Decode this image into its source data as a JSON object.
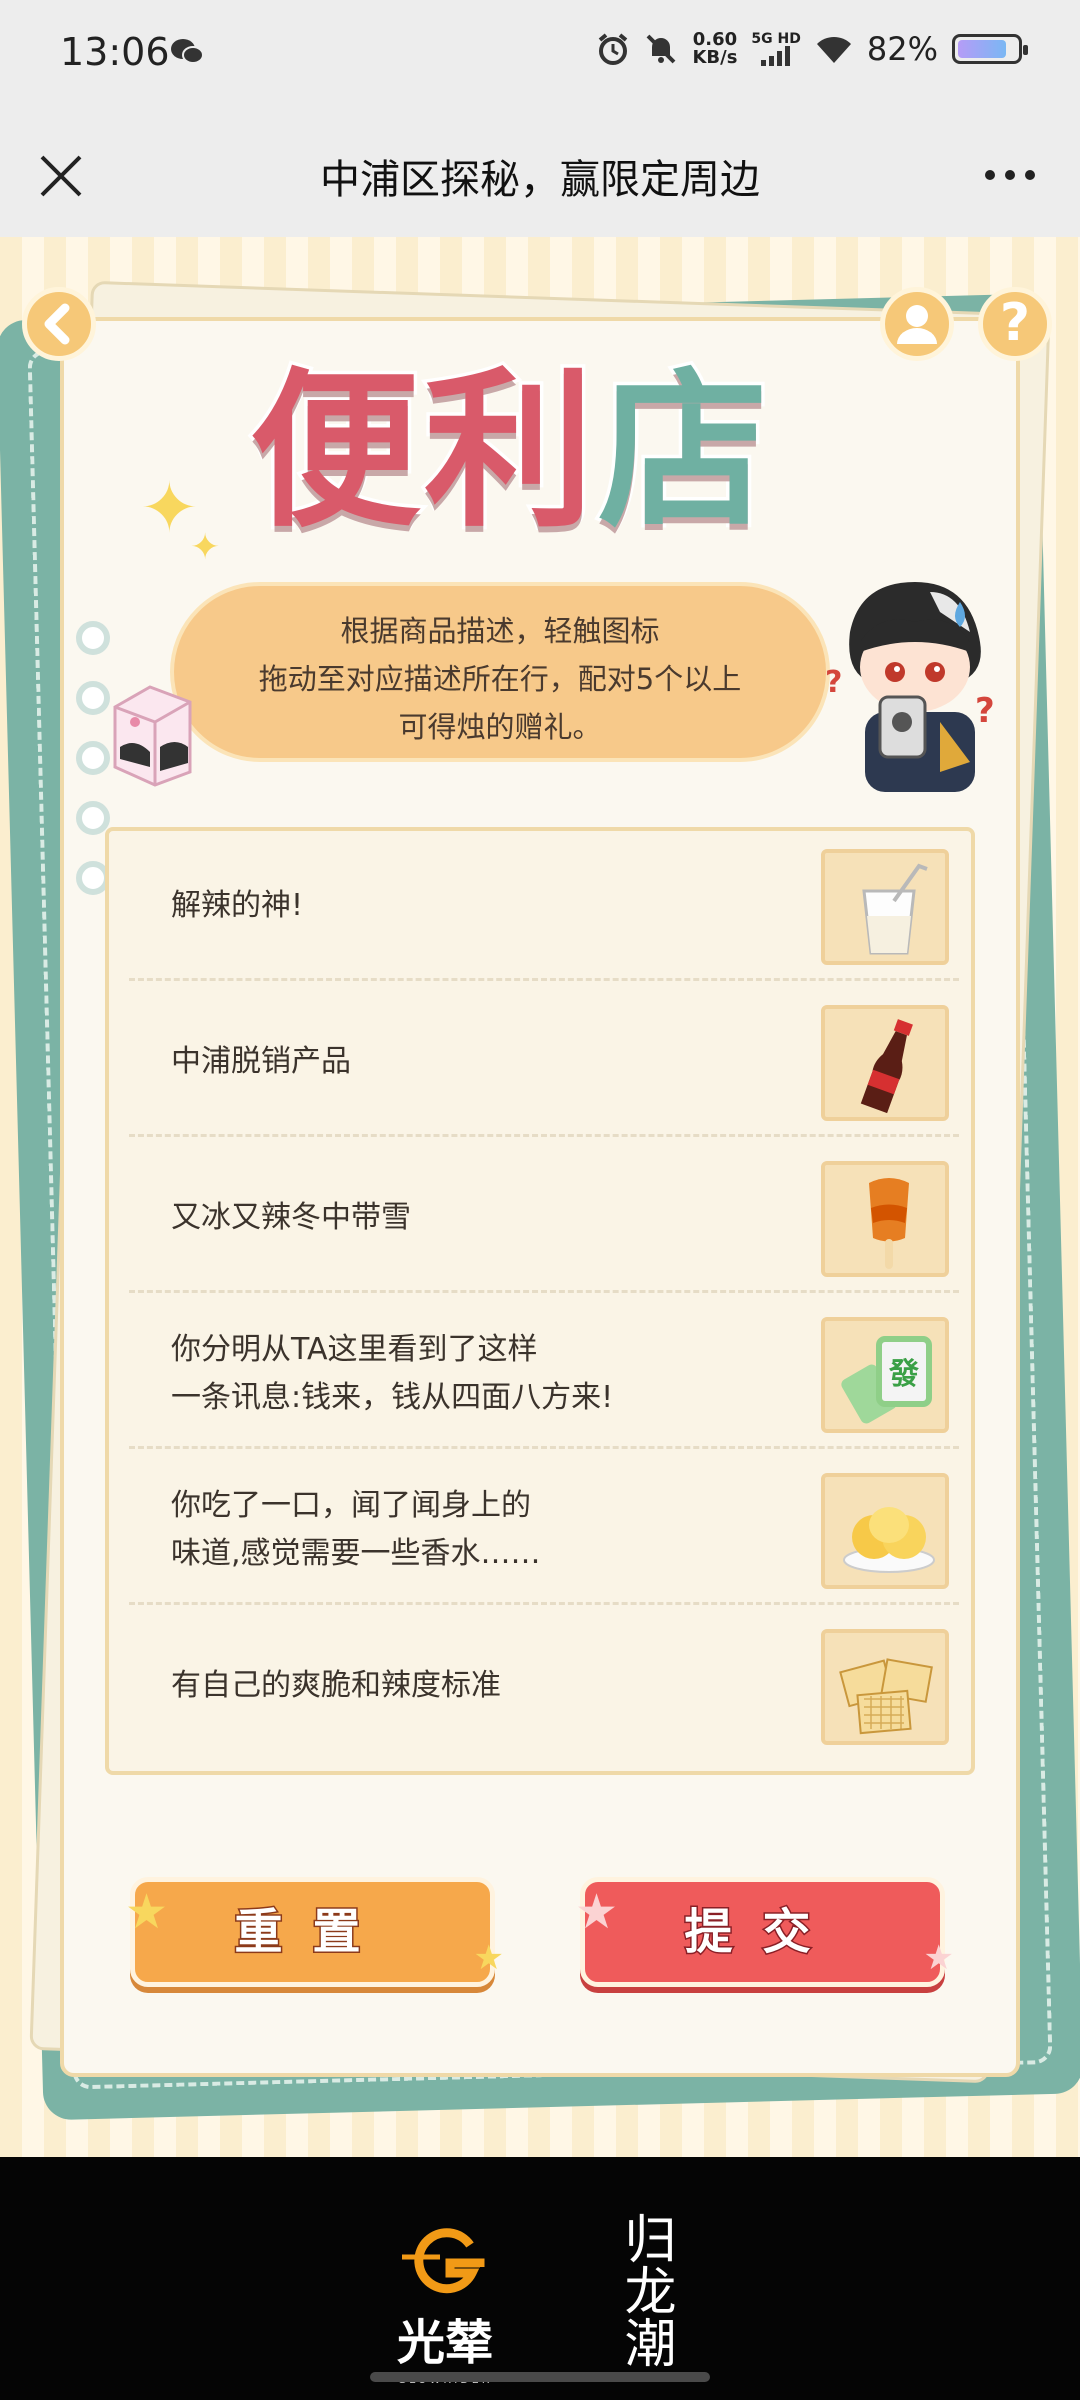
{
  "status_bar": {
    "time": "13:06",
    "net_speed_value": "0.60",
    "net_speed_unit": "KB/s",
    "network": "5G HD",
    "battery": "82%",
    "battery_level": 0.82
  },
  "title_bar": {
    "title": "中浦区探秘，赢限定周边"
  },
  "game": {
    "logo": [
      "便",
      "利",
      "店"
    ],
    "instructions": [
      "根据商品描述，轻触图标",
      "拖动至对应描述所在行，配对5个以上",
      "可得烛的赠礼。"
    ],
    "help_label": "?",
    "rows": [
      {
        "text": "解辣的神!",
        "icon": "milk-glass-icon"
      },
      {
        "text": "中浦脱销产品",
        "icon": "cola-bottle-icon"
      },
      {
        "text": "又冰又辣冬中带雪",
        "icon": "popsicle-icon"
      },
      {
        "text": "你分明从TA这里看到了这样\n一条讯息:钱来，钱从四面八方来!",
        "icon": "mahjong-tile-icon"
      },
      {
        "text": "你吃了一口，闻了闻身上的\n味道,感觉需要一些香水……",
        "icon": "buns-icon"
      },
      {
        "text": "有自己的爽脆和辣度标准",
        "icon": "crackers-icon"
      }
    ],
    "reset_label": "重置",
    "submit_label": "提交"
  },
  "footer": {
    "brand1": "光辇",
    "brand1_sub": "GLOWRIDER",
    "brand2": "归龙潮"
  },
  "colors": {
    "accent_orange": "#f6a84b",
    "accent_red": "#ef5b5b",
    "frame_green": "#7bb3a5",
    "logo_pink": "#d95a6a"
  }
}
